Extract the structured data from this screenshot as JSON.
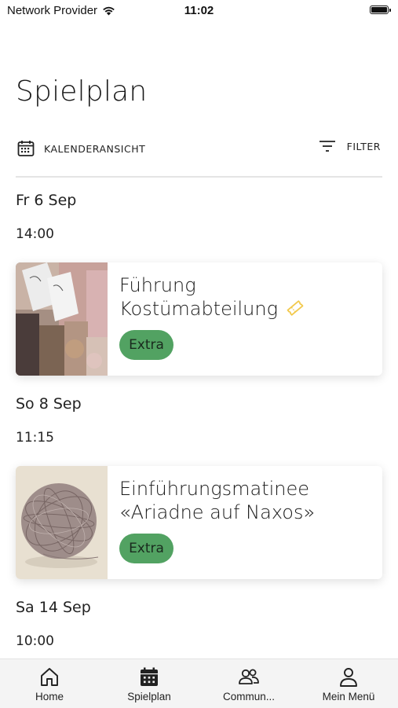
{
  "status_bar": {
    "carrier": "Network Provider",
    "time": "11:02"
  },
  "page": {
    "title": "Spielplan"
  },
  "toolbar": {
    "calendar_view_label": "KALENDERANSICHT",
    "filter_label": "FILTER"
  },
  "schedule": [
    {
      "date": "Fr 6 Sep",
      "time": "14:00",
      "event": {
        "title_line1": "Führung",
        "title_line2": "Kostümabteilung",
        "badge": "Extra",
        "has_ticket_icon": true,
        "image": "costume-rack-photo"
      }
    },
    {
      "date": "So 8 Sep",
      "time": "11:15",
      "event": {
        "title_line1": "Einführungsmatinee",
        "title_line2": "«Ariadne auf Naxos»",
        "badge": "Extra",
        "has_ticket_icon": false,
        "image": "yarn-ball-photo"
      }
    },
    {
      "date": "Sa 14 Sep",
      "time": "10:00"
    }
  ],
  "tab_bar": {
    "home": "Home",
    "spielplan": "Spielplan",
    "community": "Commun...",
    "menu": "Mein Menü"
  },
  "colors": {
    "badge": "#52a262",
    "ticket_icon": "#f2c94c",
    "tab_bar_bg": "#f4f4f4"
  }
}
